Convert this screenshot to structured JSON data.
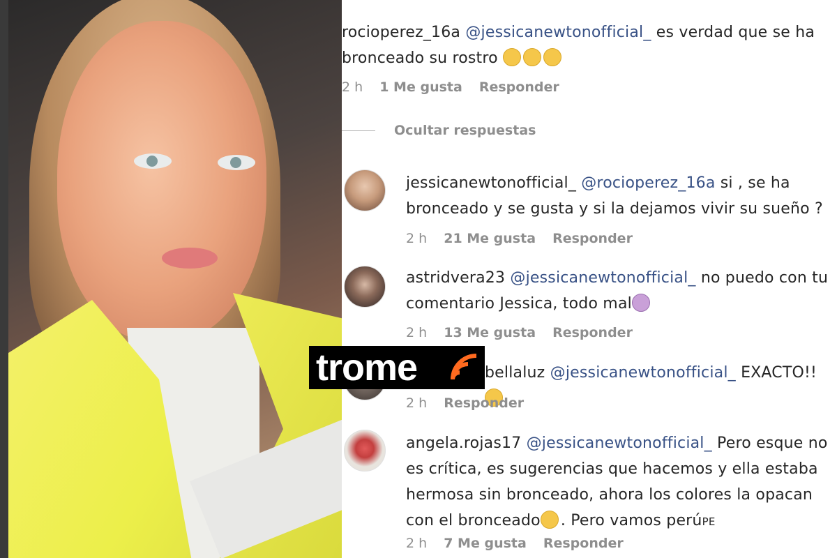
{
  "watermark": {
    "brand": "trome"
  },
  "thread": {
    "main_comment": {
      "user": "rocioperez_16a",
      "mention": "@jessicanewtonofficial_",
      "text_line1": "es verdad que se ha",
      "text_line2": "bronceado su rostro",
      "emojis": [
        "crying-face-emoji",
        "crying-face-emoji",
        "crying-face-emoji"
      ],
      "time": "2 h",
      "likes": "1 Me gusta",
      "reply": "Responder"
    },
    "hide_replies": "Ocultar respuestas",
    "replies": [
      {
        "user": "jessicanewtonofficial_",
        "mention": "@rocioperez_16a",
        "line1": "si , se ha",
        "line2": "bronceado y se gusta y si la dejamos vivir su sueño ?",
        "time": "2 h",
        "likes": "21 Me gusta",
        "reply": "Responder"
      },
      {
        "user": "astridvera23",
        "mention": "@jessicanewtonofficial_",
        "line1": "no puedo con tu",
        "line2": "comentario Jessica, todo mal",
        "emoji": "woman-facepalming-emoji",
        "time": "2 h",
        "likes": "13 Me gusta",
        "reply": "Responder"
      },
      {
        "user": "bellaluz",
        "mention": "@jessicanewtonofficial_",
        "line1": "EXACTO!!",
        "emoji": "pensive-face-emoji",
        "time": "2 h",
        "reply": "Responder"
      },
      {
        "user": "angela.rojas17",
        "mention": "@jessicanewtonofficial_",
        "line1": "Pero esque no",
        "line2": "es crítica, es sugerencias que hacemos y ella estaba",
        "line3": "hermosa sin bronceado, ahora los colores la opacan",
        "line4a": "con el bronceado",
        "line4b": ". Pero vamos perú",
        "line4c": "PE",
        "emoji": "confused-face-emoji",
        "time": "2 h",
        "likes": "7 Me gusta",
        "reply": "Responder"
      }
    ]
  },
  "colors": {
    "mention": "#385185",
    "meta": "#8e8e8e",
    "jacket": "#ecef4a"
  }
}
